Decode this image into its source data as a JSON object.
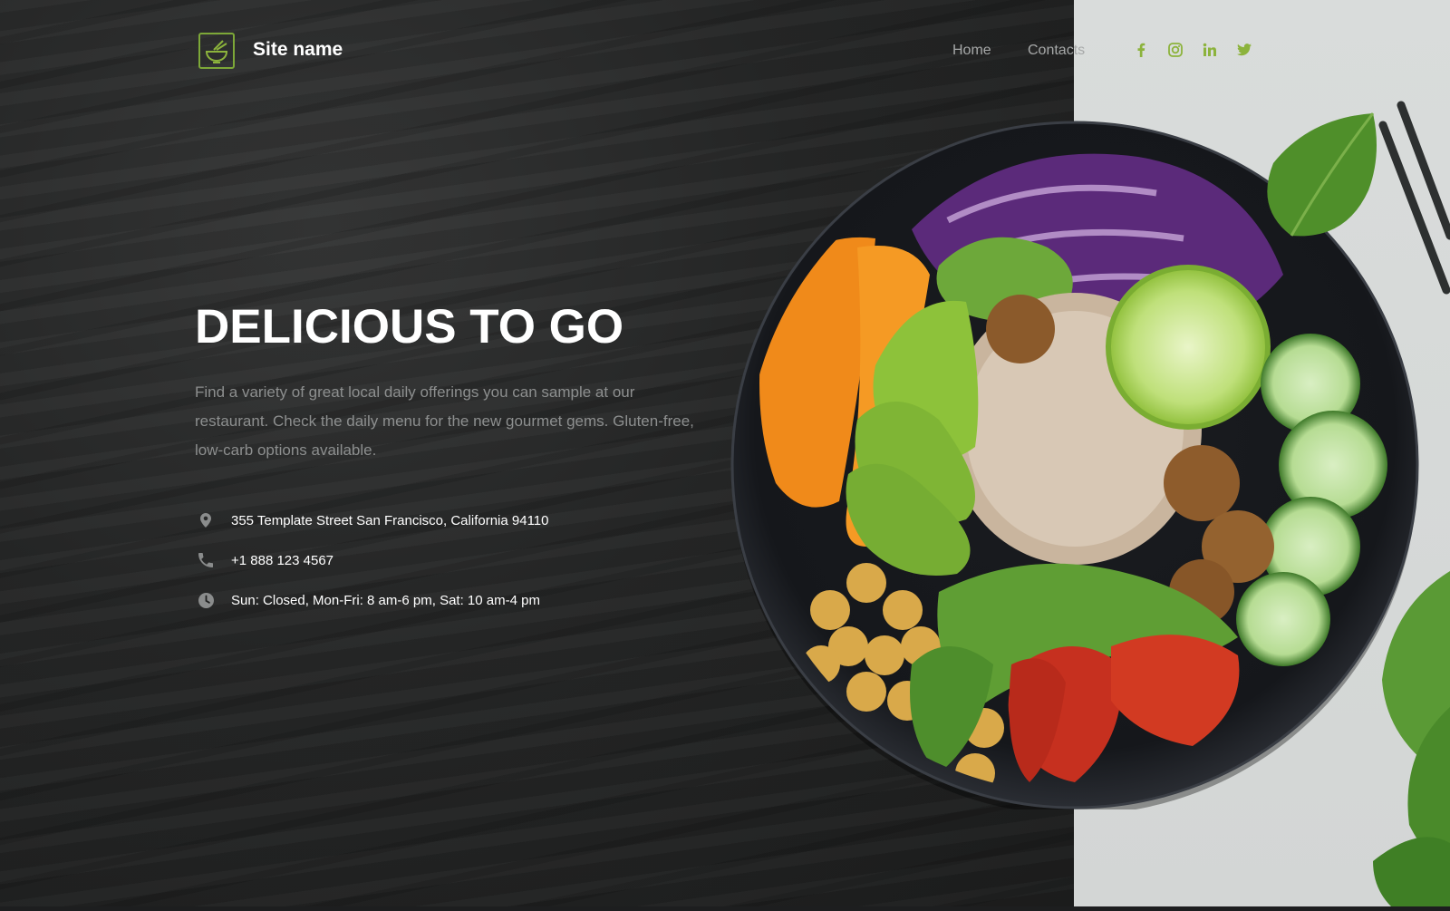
{
  "header": {
    "site_name": "Site name",
    "logo_icon": "bowl-chopsticks-icon",
    "nav": [
      {
        "label": "Home"
      },
      {
        "label": "Contacts"
      }
    ],
    "social": [
      {
        "icon": "facebook-icon"
      },
      {
        "icon": "instagram-icon"
      },
      {
        "icon": "linkedin-icon"
      },
      {
        "icon": "twitter-icon"
      }
    ]
  },
  "hero": {
    "title": "DELICIOUS TO GO",
    "description": "Find a variety of great local daily offerings you can sample at our restaurant. Check the daily menu for the new gourmet gems. Gluten-free, low-carb options available."
  },
  "contact": [
    {
      "icon": "location-pin-icon",
      "text": "355 Template Street San Francisco, California 94110"
    },
    {
      "icon": "phone-icon",
      "text": "+1 888 123 4567"
    },
    {
      "icon": "clock-icon",
      "text": "Sun: Closed, Mon-Fri: 8 am-6 pm, Sat: 10 am-4 pm"
    }
  ],
  "colors": {
    "accent": "#8cb33c",
    "background_dark": "#1d1e1f",
    "background_light": "#d9dcdb",
    "text_muted": "#8d8f8f"
  }
}
